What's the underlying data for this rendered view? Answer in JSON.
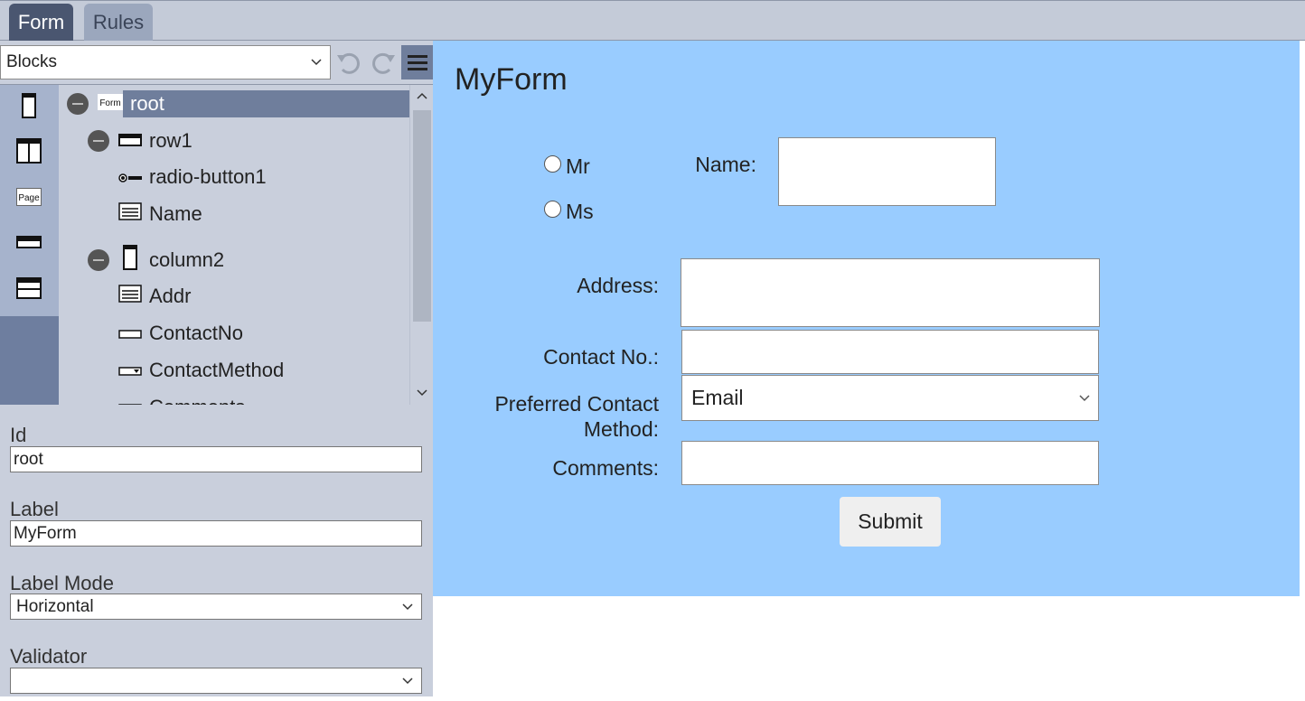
{
  "tabs": [
    {
      "label": "Form",
      "active": true
    },
    {
      "label": "Rules",
      "active": false
    }
  ],
  "toolbar": {
    "blocks_select": "Blocks",
    "undo_icon": "undo-icon",
    "redo_icon": "redo-icon",
    "menu_icon": "hamburger-menu-icon"
  },
  "palette": [
    "column-block-icon",
    "two-column-block-icon",
    "page-block-icon",
    "row-block-icon",
    "header-row-block-icon"
  ],
  "palette_page_text": "Page",
  "tree": {
    "form_icon_text": "Form",
    "items": [
      {
        "label": "root",
        "icon": "form-icon",
        "selected": true
      },
      {
        "label": "row1",
        "icon": "row-icon"
      },
      {
        "label": "radio-button1",
        "icon": "radio-button-icon"
      },
      {
        "label": "Name",
        "icon": "text-area-icon"
      },
      {
        "label": "column2",
        "icon": "column-icon"
      },
      {
        "label": "Addr",
        "icon": "text-area-icon"
      },
      {
        "label": "ContactNo",
        "icon": "text-input-icon"
      },
      {
        "label": "ContactMethod",
        "icon": "dropdown-icon"
      },
      {
        "label": "Comments",
        "icon": "text-input-icon"
      }
    ]
  },
  "properties": {
    "id_label": "Id",
    "id_value": "root",
    "label_label": "Label",
    "label_value": "MyForm",
    "label_mode_label": "Label Mode",
    "label_mode_value": "Horizontal",
    "validator_label": "Validator",
    "validator_value": ""
  },
  "form": {
    "title": "MyForm",
    "radio_options": [
      "Mr",
      "Ms"
    ],
    "name_label": "Name:",
    "address_label": "Address:",
    "contact_label": "Contact No.:",
    "preferred_label_line1": "Preferred Contact",
    "preferred_label_line2": "Method:",
    "preferred_value": "Email",
    "comments_label": "Comments:",
    "submit_label": "Submit"
  },
  "colors": {
    "canvas_bg": "#99ccff",
    "panel_bg": "#c9cfdc",
    "selected_bg": "#6f7e9c",
    "active_tab": "#4a5670"
  }
}
